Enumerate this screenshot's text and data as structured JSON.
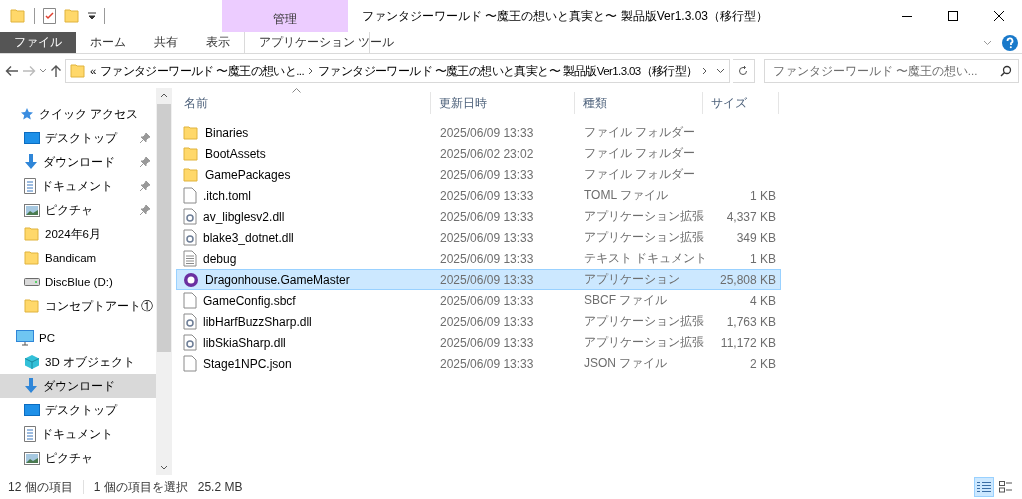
{
  "window": {
    "title": "ファンタジーワールド 〜魔王の想いと真実と〜 製品版Ver1.3.03（移行型）"
  },
  "ribbon": {
    "tabs": [
      {
        "label": "ファイル",
        "kind": "file",
        "selected": false
      },
      {
        "label": "ホーム",
        "kind": "tab",
        "selected": false
      },
      {
        "label": "共有",
        "kind": "tab",
        "selected": false
      },
      {
        "label": "表示",
        "kind": "tab",
        "selected": false
      }
    ],
    "context_group": {
      "label": "管理",
      "tabs": [
        {
          "label": "アプリケーション ツール",
          "kind": "tab",
          "selected": false
        }
      ]
    }
  },
  "address_bar": {
    "overflow_mark": "«",
    "segments": [
      "ファンタジーワールド 〜魔王の想いと...",
      "ファンタジーワールド 〜魔王の想いと真実と〜 製品版Ver1.3.03（移行型）"
    ]
  },
  "search": {
    "placeholder": "ファンタジーワールド 〜魔王の想い..."
  },
  "sidebar": {
    "sections": [
      {
        "label": "クイック アクセス",
        "kind": "star",
        "items": [
          {
            "label": "デスクトップ",
            "kind": "desktop",
            "pinned": true,
            "selected": false
          },
          {
            "label": "ダウンロード",
            "kind": "download",
            "pinned": true,
            "selected": false
          },
          {
            "label": "ドキュメント",
            "kind": "document",
            "pinned": true,
            "selected": false
          },
          {
            "label": "ピクチャ",
            "kind": "picture",
            "pinned": true,
            "selected": false
          },
          {
            "label": "2024年6月",
            "kind": "folder",
            "pinned": false,
            "selected": false
          },
          {
            "label": "Bandicam",
            "kind": "folder",
            "pinned": false,
            "selected": false
          },
          {
            "label": "DiscBlue (D:)",
            "kind": "drive",
            "pinned": false,
            "selected": false
          },
          {
            "label": "コンセプトアート①",
            "kind": "folder",
            "pinned": false,
            "selected": false
          }
        ]
      },
      {
        "label": "PC",
        "kind": "pc",
        "items": [
          {
            "label": "3D オブジェクト",
            "kind": "cube",
            "pinned": false,
            "selected": false
          },
          {
            "label": "ダウンロード",
            "kind": "download",
            "pinned": false,
            "selected": true
          },
          {
            "label": "デスクトップ",
            "kind": "desktop",
            "pinned": false,
            "selected": false
          },
          {
            "label": "ドキュメント",
            "kind": "document",
            "pinned": false,
            "selected": false
          },
          {
            "label": "ピクチャ",
            "kind": "picture",
            "pinned": false,
            "selected": false
          }
        ]
      }
    ]
  },
  "table": {
    "columns": [
      "名前",
      "更新日時",
      "種類",
      "サイズ"
    ],
    "rows": [
      {
        "kind": "folder",
        "name": "Binaries",
        "modified": "2025/06/09 13:33",
        "type": "ファイル フォルダー",
        "size": null,
        "selected": false
      },
      {
        "kind": "folder",
        "name": "BootAssets",
        "modified": "2025/06/02 23:02",
        "type": "ファイル フォルダー",
        "size": null,
        "selected": false
      },
      {
        "kind": "folder",
        "name": "GamePackages",
        "modified": "2025/06/09 13:33",
        "type": "ファイル フォルダー",
        "size": null,
        "selected": false
      },
      {
        "kind": "file",
        "name": ".itch.toml",
        "modified": "2025/06/09 13:33",
        "type": "TOML ファイル",
        "size": "1 KB",
        "selected": false
      },
      {
        "kind": "dll",
        "name": "av_libglesv2.dll",
        "modified": "2025/06/09 13:33",
        "type": "アプリケーション拡張",
        "size": "4,337 KB",
        "selected": false
      },
      {
        "kind": "dll",
        "name": "blake3_dotnet.dll",
        "modified": "2025/06/09 13:33",
        "type": "アプリケーション拡張",
        "size": "349 KB",
        "selected": false
      },
      {
        "kind": "text",
        "name": "debug",
        "modified": "2025/06/09 13:33",
        "type": "テキスト ドキュメント",
        "size": "1 KB",
        "selected": false
      },
      {
        "kind": "app",
        "name": "Dragonhouse.GameMaster",
        "modified": "2025/06/09 13:33",
        "type": "アプリケーション",
        "size": "25,808 KB",
        "selected": true
      },
      {
        "kind": "file",
        "name": "GameConfig.sbcf",
        "modified": "2025/06/09 13:33",
        "type": "SBCF ファイル",
        "size": "4 KB",
        "selected": false
      },
      {
        "kind": "dll",
        "name": "libHarfBuzzSharp.dll",
        "modified": "2025/06/09 13:33",
        "type": "アプリケーション拡張",
        "size": "1,763 KB",
        "selected": false
      },
      {
        "kind": "dll",
        "name": "libSkiaSharp.dll",
        "modified": "2025/06/09 13:33",
        "type": "アプリケーション拡張",
        "size": "11,172 KB",
        "selected": false
      },
      {
        "kind": "file",
        "name": "Stage1NPC.json",
        "modified": "2025/06/09 13:33",
        "type": "JSON ファイル",
        "size": "2 KB",
        "selected": false
      }
    ]
  },
  "status_bar": {
    "item_count": "12 個の項目",
    "selection": "1 個の項目を選択",
    "selection_size": "25.2 MB"
  },
  "view_buttons": [
    {
      "kind": "details",
      "selected": true
    },
    {
      "kind": "tiles",
      "selected": false
    }
  ]
}
